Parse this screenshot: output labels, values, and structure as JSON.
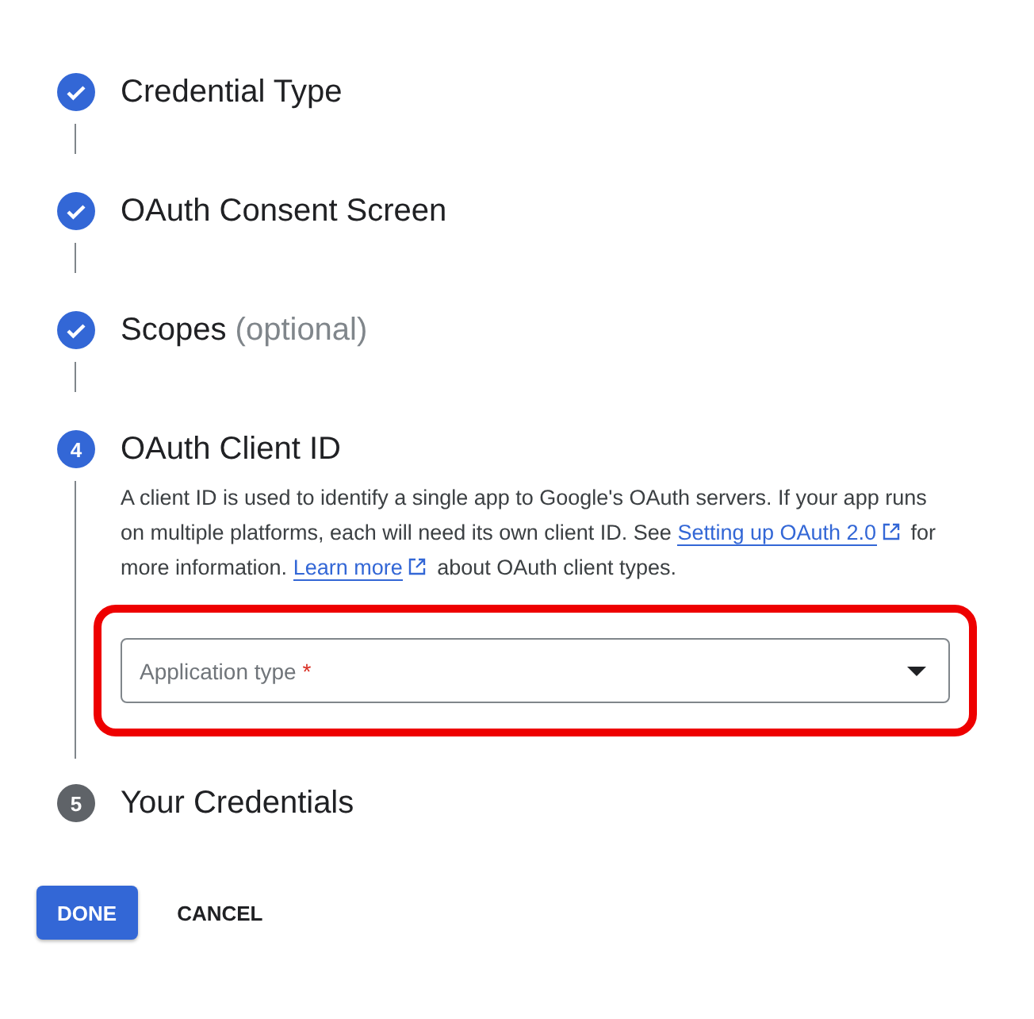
{
  "steps": [
    {
      "completed": true,
      "active": false,
      "title": "Credential Type"
    },
    {
      "completed": true,
      "active": false,
      "title": "OAuth Consent Screen"
    },
    {
      "completed": true,
      "active": false,
      "title": "Scopes",
      "note": "(optional)"
    },
    {
      "completed": false,
      "active": true,
      "number": "4",
      "title": "OAuth Client ID",
      "description": [
        {
          "kind": "text",
          "text": "A client ID is used to identify a single app to Google's OAuth servers. If your app runs on multiple platforms, each will need its own client ID. See"
        },
        {
          "kind": "link",
          "text": "Setting up OAuth 2.0"
        },
        {
          "kind": "text",
          "text": "for more information."
        },
        {
          "kind": "link",
          "text": "Learn more"
        },
        {
          "kind": "text",
          "text": "about OAuth client types."
        }
      ],
      "field": {
        "placeholder": "Application type",
        "required_mark": "*",
        "highlighted": true
      }
    },
    {
      "completed": false,
      "active": false,
      "number": "5",
      "title": "Your Credentials"
    }
  ],
  "buttons": [
    {
      "label": "DONE",
      "kind": "primary"
    },
    {
      "label": "CANCEL",
      "kind": "text"
    }
  ]
}
